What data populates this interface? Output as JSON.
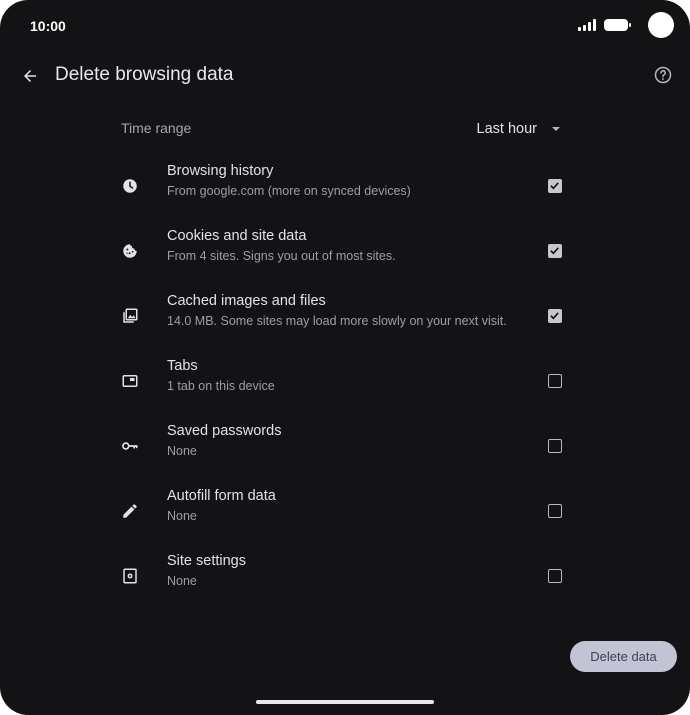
{
  "status_bar": {
    "time": "10:00"
  },
  "header": {
    "title": "Delete browsing data"
  },
  "time_range": {
    "label": "Time range",
    "value": "Last hour"
  },
  "items": [
    {
      "title": "Browsing history",
      "subtitle": "From google.com (more on synced devices)",
      "checked": true,
      "icon": "clock-icon"
    },
    {
      "title": "Cookies and site data",
      "subtitle": "From 4 sites. Signs you out of most sites.",
      "checked": true,
      "icon": "cookie-icon"
    },
    {
      "title": "Cached images and files",
      "subtitle": "14.0 MB. Some sites may load more slowly on your next visit.",
      "checked": true,
      "icon": "images-icon"
    },
    {
      "title": "Tabs",
      "subtitle": "1 tab on this device",
      "checked": false,
      "icon": "tab-icon"
    },
    {
      "title": "Saved passwords",
      "subtitle": "None",
      "checked": false,
      "icon": "key-icon"
    },
    {
      "title": "Autofill form data",
      "subtitle": "None",
      "checked": false,
      "icon": "pencil-icon"
    },
    {
      "title": "Site settings",
      "subtitle": "None",
      "checked": false,
      "icon": "site-settings-icon"
    }
  ],
  "actions": {
    "delete_label": "Delete data"
  },
  "colors": {
    "background": "#131316",
    "button_bg": "#c2c4d6",
    "checkbox_checked": "#c5c6ce"
  }
}
